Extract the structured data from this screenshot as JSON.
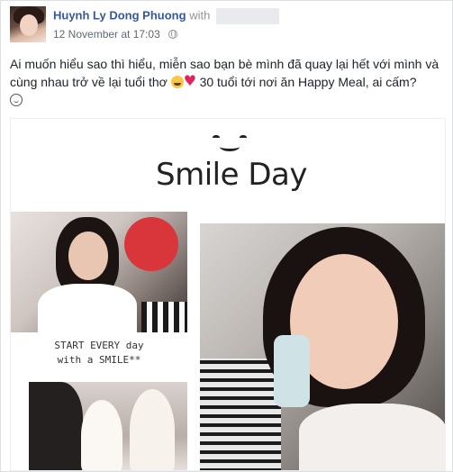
{
  "post": {
    "author_name": "Huynh Ly Dong Phuong",
    "with_label": "with",
    "timestamp": "12 November at 17:03",
    "text_line1": "Ai muốn hiểu sao thì hiểu, miễn sao bạn bè mình đã quay lại hết với mình và",
    "text_line2_before": "cùng nhau trở về lại tuổi thơ",
    "text_line2_after": " 30 tuổi tới nơi ăn Happy Meal, ai cấm?",
    "emojis": [
      "grinning-heart-eyes-emoji",
      "heart-emoji",
      "smile-emoji"
    ]
  },
  "photo": {
    "title": "Smile Day",
    "caption_line1": "START EVERY day",
    "caption_line2": "with a SMILE**"
  },
  "colors": {
    "author_link": "#365899",
    "meta_text": "#616770",
    "body_text": "#1d2129"
  }
}
